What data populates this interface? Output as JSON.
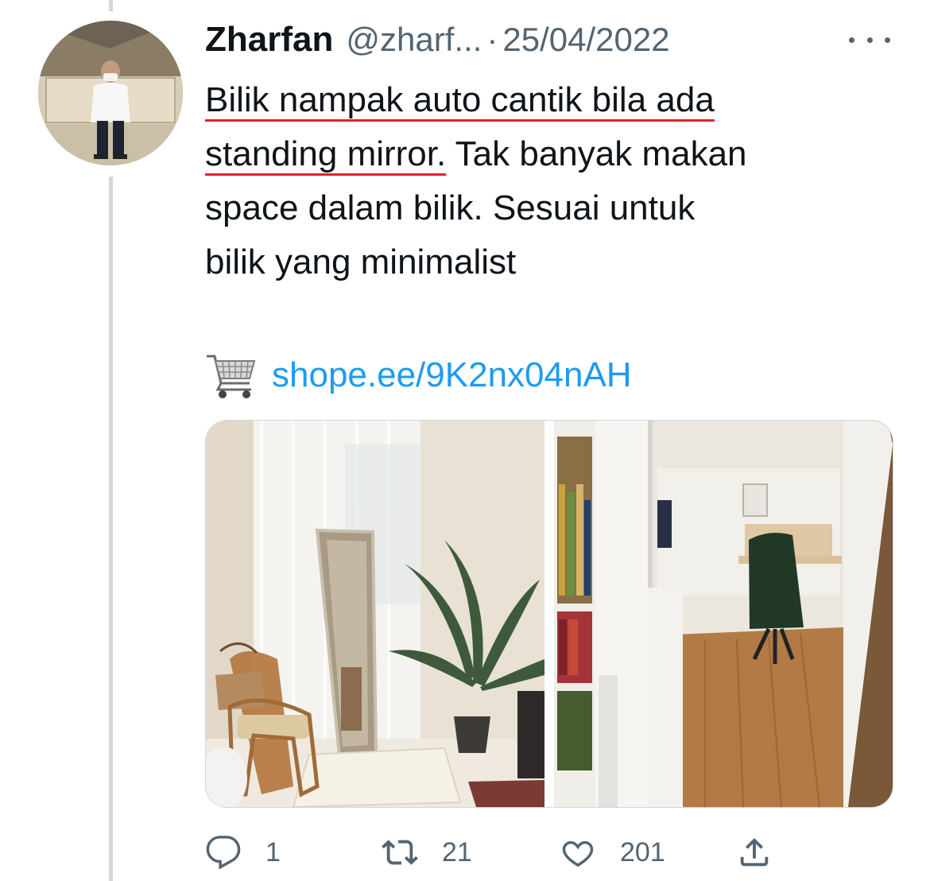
{
  "tweet": {
    "author_name": "Zharfan",
    "author_handle": "@zharf...",
    "separator": "·",
    "date": "25/04/2022",
    "text_lines": [
      {
        "underlined": "Bilik nampak auto cantik bila ada",
        "rest": ""
      },
      {
        "underlined": "standing mirror.",
        "rest": " Tak banyak makan"
      },
      {
        "underlined": "",
        "rest": "space dalam bilik. Sesuai untuk"
      },
      {
        "underlined": "",
        "rest": "bilik yang minimalist"
      }
    ],
    "link_emoji": "shopping-cart-icon",
    "link_text": "shope.ee/9K2nx04nAH",
    "media": [
      {
        "name": "room-with-standing-mirror-photo"
      },
      {
        "name": "mirror-reflecting-bedroom-photo"
      }
    ]
  },
  "actions": {
    "reply_count": "1",
    "retweet_count": "21",
    "like_count": "201"
  },
  "colors": {
    "link": "#1d9bf0",
    "secondary_text": "#536471",
    "underline": "#e0222c",
    "thread_line": "#cfd9de"
  }
}
